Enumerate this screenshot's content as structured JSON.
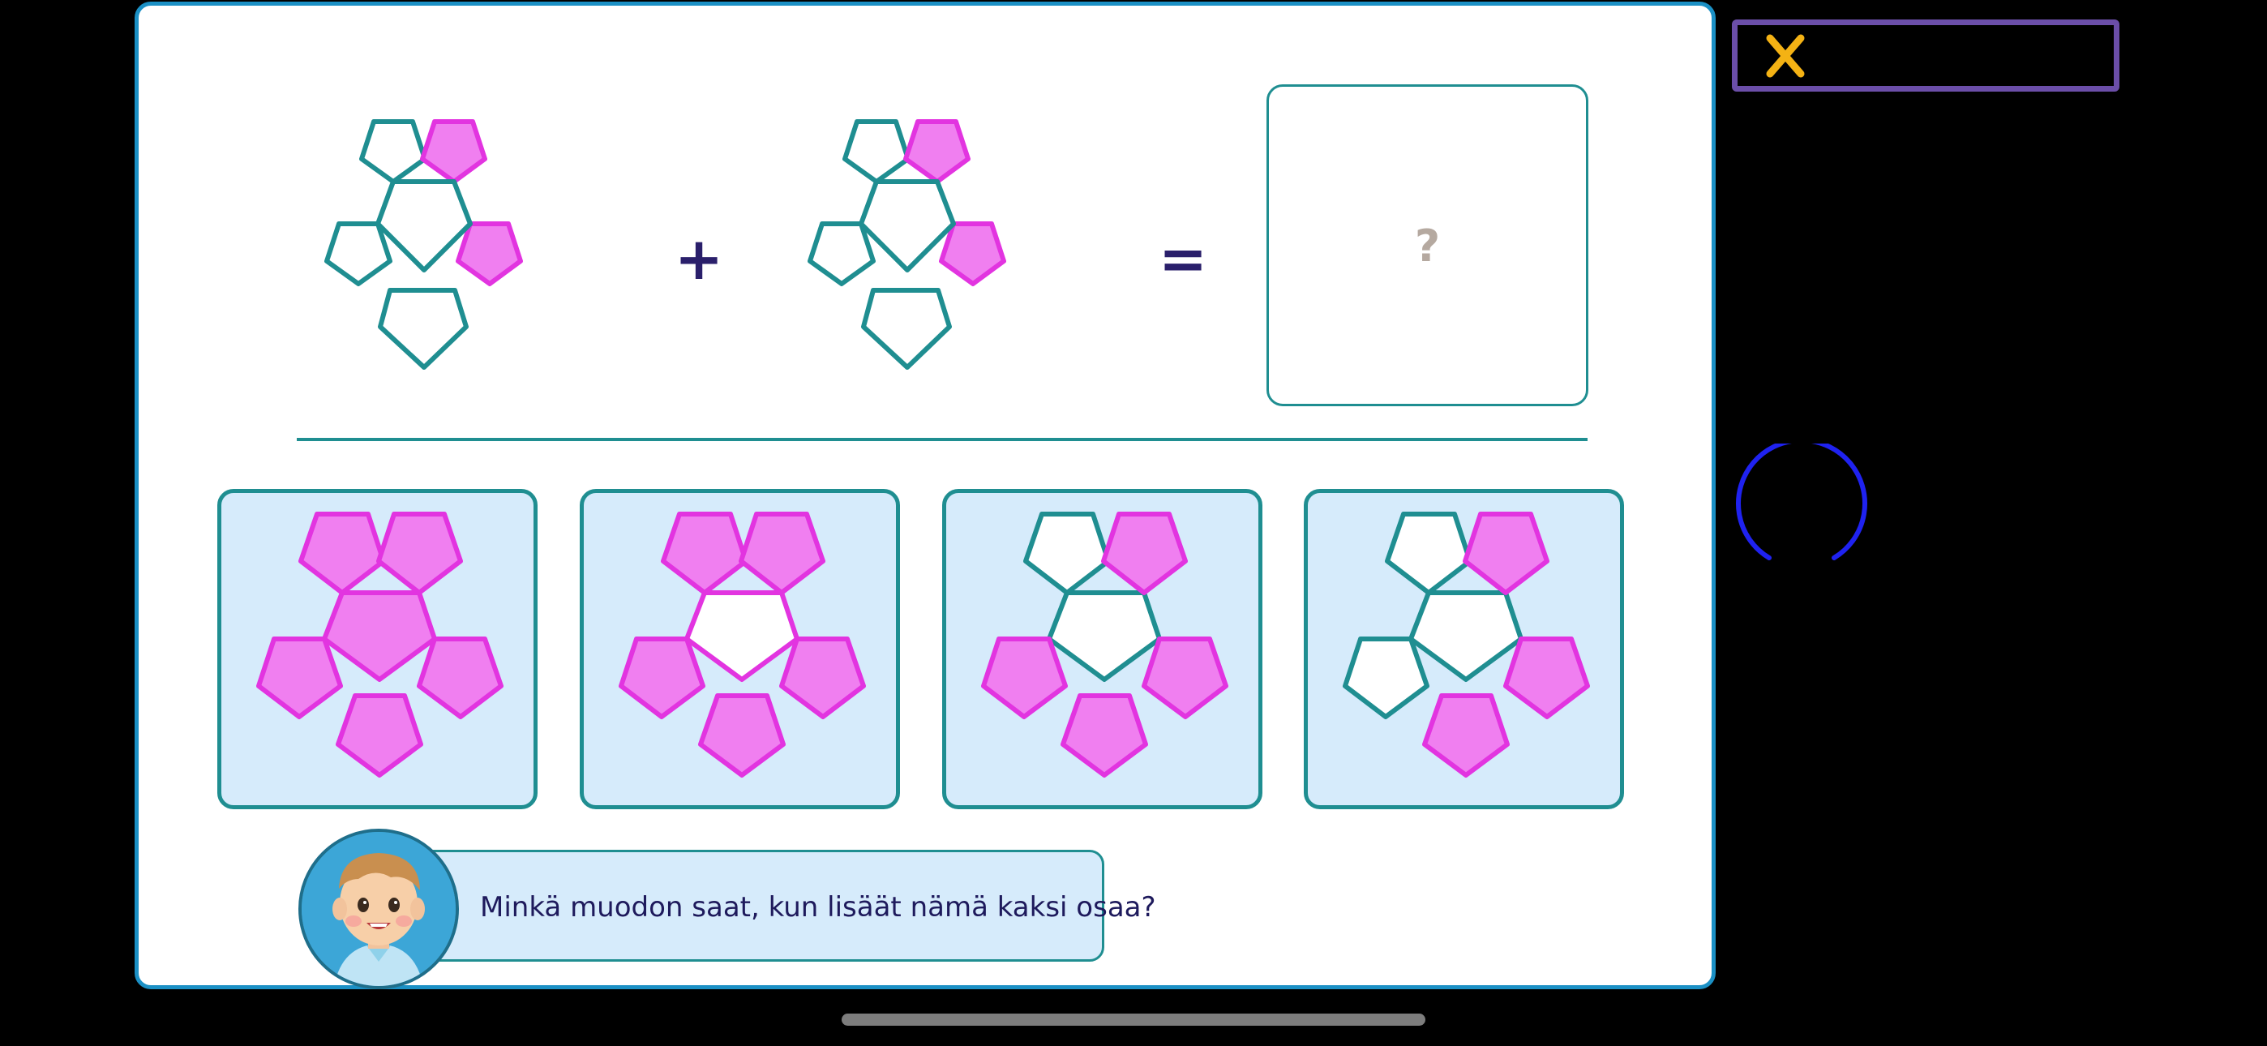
{
  "equation": {
    "plus_label": "+",
    "equals_label": "=",
    "answer_placeholder": "?"
  },
  "options": [
    {
      "name": "all-filled"
    },
    {
      "name": "center-empty"
    },
    {
      "name": "center-and-top-left-empty"
    },
    {
      "name": "center-top-left-left-bottom-empty"
    }
  ],
  "prompt": {
    "text": "Minkä muodon saat, kun lisäät nämä kaksi osaa?"
  },
  "colors": {
    "pink_fill": "#f07ff0",
    "pink_stroke": "#e234e0",
    "teal_stroke": "#1f8e91",
    "panel_border": "#1b90c5",
    "option_bg": "#d6ebfb"
  }
}
